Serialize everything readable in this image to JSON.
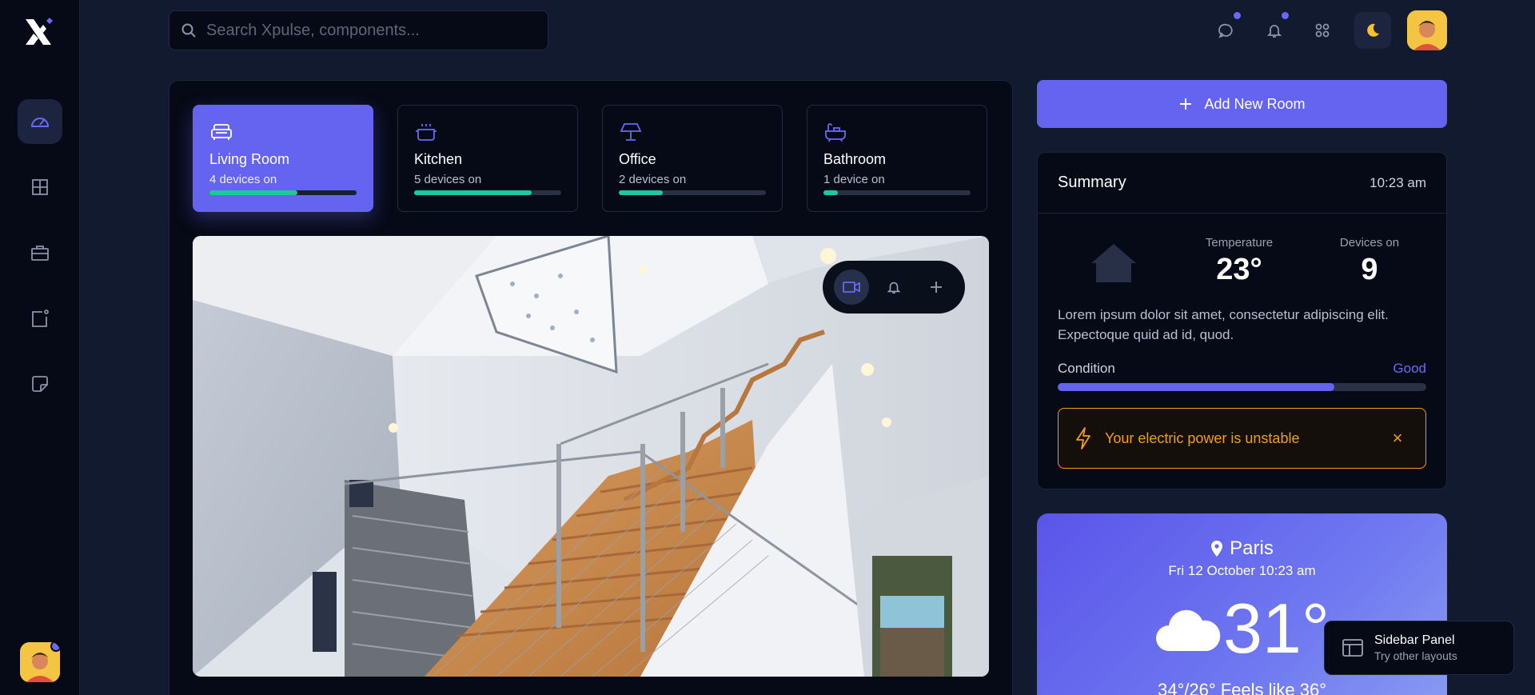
{
  "search": {
    "placeholder": "Search Xpulse, components..."
  },
  "sidebar": {
    "items": [
      {
        "icon": "gauge-icon",
        "active": true
      },
      {
        "icon": "grid-icon",
        "active": false
      },
      {
        "icon": "briefcase-icon",
        "active": false
      },
      {
        "icon": "square-dot-icon",
        "active": false
      },
      {
        "icon": "sticky-note-icon",
        "active": false
      }
    ]
  },
  "rooms": [
    {
      "name": "Living Room",
      "status": "4 devices on",
      "level": 0.6,
      "active": true
    },
    {
      "name": "Kitchen",
      "status": "5 devices on",
      "level": 0.8,
      "active": false
    },
    {
      "name": "Office",
      "status": "2 devices on",
      "level": 0.3,
      "active": false
    },
    {
      "name": "Bathroom",
      "status": "1 device on",
      "level": 0.1,
      "active": false
    }
  ],
  "add_room": {
    "label": "Add New Room"
  },
  "summary": {
    "title": "Summary",
    "time": "10:23 am",
    "temperature_label": "Temperature",
    "temperature_value": "23°",
    "devices_label": "Devices on",
    "devices_value": "9",
    "description": "Lorem ipsum dolor sit amet, consectetur adipiscing elit. Expectoque quid ad id, quod.",
    "condition_label": "Condition",
    "condition_value": "Good",
    "condition_level": 0.75,
    "alert_message": "Your electric power is unstable",
    "alert_close": "×"
  },
  "weather": {
    "city": "Paris",
    "date": "Fri 12 October 10:23 am",
    "temp": "31°",
    "feels": "34°/26° Feels like 36°"
  },
  "toast": {
    "title": "Sidebar Panel",
    "subtitle": "Try other layouts"
  },
  "colors": {
    "accent": "#6564f0",
    "progress": "#1fc7a0",
    "warning": "#f59e0b"
  }
}
